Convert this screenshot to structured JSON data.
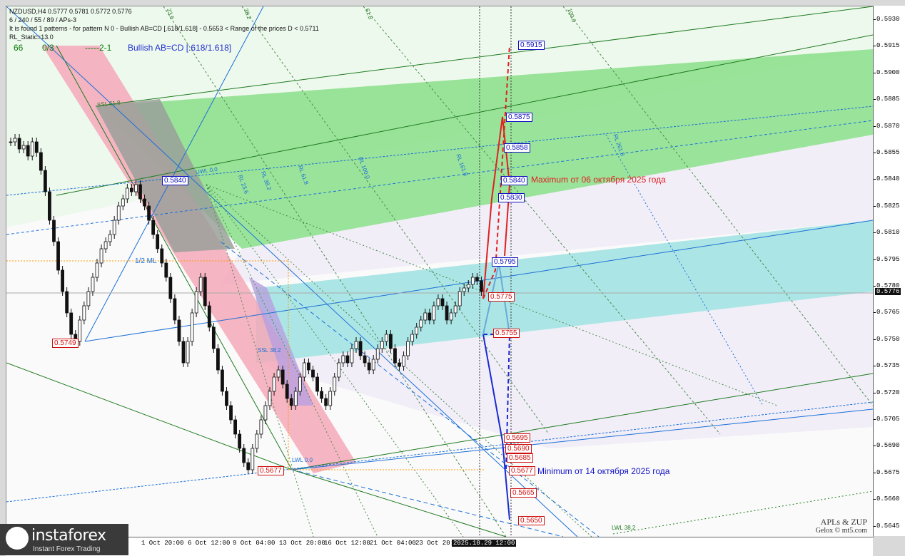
{
  "header": {
    "symbol_line": "NZDUSD,H4  0.5777 0.5781 0.5772 0.5776",
    "params_line": "6 / 240 / 55 / 89 / APs-3",
    "pattern_line": "It is found 1 patterns  -  for pattern N 0 - Bullish AB=CD [.618/1.618] - 0.5653 < Range of the prices D < 0.5711",
    "static_line": "RL_Static=13.0",
    "stat_a": "66",
    "stat_b": "0/3",
    "stat_c": "-----2-1",
    "pattern_name": "Bullish AB=CD [.618/1.618]"
  },
  "levels": {
    "l5915": "0.5915",
    "l5875": "0.5875",
    "l5858": "0.5858",
    "l5840a": "0.5840",
    "l5840b": "0.5840",
    "l5830": "0.5830",
    "l5795": "0.5795",
    "l5775": "0.5775",
    "l5755": "0.5755",
    "l5749": "0.5749",
    "l5695": "0.5695",
    "l5690": "0.5690",
    "l5685": "0.5685",
    "l5677a": "0.5677",
    "l5677b": "0.5677",
    "l5665": "0.5665",
    "l5650": "0.5650"
  },
  "notes": {
    "max_note": "Maximum от 06 октября 2025 года",
    "min_note": "Minimum от 14 октября 2025 года"
  },
  "line_labels": {
    "ssl618": "SSL 61.8",
    "uwl00": "UWL 0.0",
    "rl236": "RL 23.6",
    "rl382": "RL 38.2",
    "rl618": "RL 61.8",
    "rl1000": "RL 100.0",
    "rl1618": "RL 161.8",
    "rl2618": "RL 261.8",
    "ml": "1/2 ML",
    "lwl00": "LWL 0.0",
    "lwl382": "LWL 38.2",
    "ssl382": "SSL 38.2",
    "top236": "23.6",
    "top382": "38.2",
    "top618": "61.8",
    "top1000": "100.0"
  },
  "price_axis": {
    "ticks": [
      "0.5930",
      "0.5915",
      "0.5900",
      "0.5885",
      "0.5870",
      "0.5855",
      "0.5840",
      "0.5825",
      "0.5810",
      "0.5795",
      "0.5780",
      "0.5765",
      "0.5750",
      "0.5735",
      "0.5720",
      "0.5705",
      "0.5690",
      "0.5675",
      "0.5660",
      "0.5645"
    ],
    "current": "0.5776"
  },
  "time_axis": {
    "ticks": [
      "1 Oct 20:00",
      "6 Oct 12:00",
      "9 Oct 04:00",
      "13 Oct 20:00",
      "16 Oct 12:00",
      "21 Oct 04:00",
      "23 Oct 20:00"
    ],
    "highlight": "2025.10.29 12:00"
  },
  "signature": {
    "line1": "APLs & ZUP",
    "line2": "Gelox © mt5.com"
  },
  "logo": {
    "name": "instaforex",
    "tag": "Instant Forex Trading"
  },
  "colors": {
    "bull_red": "#e02020",
    "bear_blue": "#1a2ad0",
    "green_fill": "#8fe08f",
    "cyan_fill": "#a8e4e4",
    "pink_fill": "#f5a8b8",
    "candle": "#111111"
  }
}
